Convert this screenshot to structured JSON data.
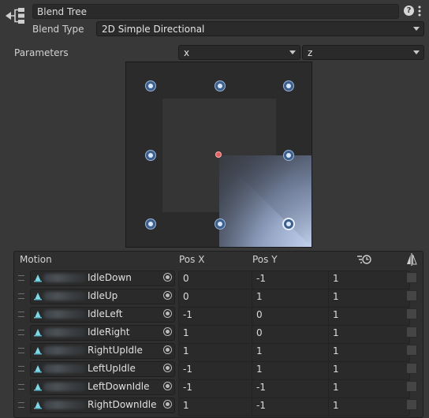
{
  "header": {
    "name_value": "Blend Tree",
    "blend_type_label": "Blend Type",
    "blend_type_value": "2D Simple Directional"
  },
  "parameters": {
    "label": "Parameters",
    "x_param": "x",
    "y_param": "z"
  },
  "table": {
    "headers": {
      "motion": "Motion",
      "pos_x": "Pos X",
      "pos_y": "Pos Y"
    },
    "rows": [
      {
        "motion": "IdleDown",
        "pos_x": "0",
        "pos_y": "-1",
        "speed": "1"
      },
      {
        "motion": "IdleUp",
        "pos_x": "0",
        "pos_y": "1",
        "speed": "1"
      },
      {
        "motion": "IdleLeft",
        "pos_x": "-1",
        "pos_y": "0",
        "speed": "1"
      },
      {
        "motion": "IdleRight",
        "pos_x": "1",
        "pos_y": "0",
        "speed": "1"
      },
      {
        "motion": "RightUpIdle",
        "pos_x": "1",
        "pos_y": "1",
        "speed": "1"
      },
      {
        "motion": "LeftUpIdle",
        "pos_x": "-1",
        "pos_y": "1",
        "speed": "1"
      },
      {
        "motion": "LeftDownIdle",
        "pos_x": "-1",
        "pos_y": "-1",
        "speed": "1"
      },
      {
        "motion": "RightDownIdle",
        "pos_x": "1",
        "pos_y": "-1",
        "speed": "1"
      }
    ]
  },
  "icons": {
    "blend_tree": "blend-tree-icon",
    "help": "help-icon",
    "menu": "kebab-menu-icon",
    "time_scale": "time-scale-icon",
    "mirror": "mirror-icon",
    "motion": "animation-clip-icon",
    "picker": "object-picker-icon"
  },
  "colors": {
    "background": "#383838",
    "field": "#2a2a2a",
    "point": "#3c5f8c",
    "current_point": "#e06060"
  }
}
